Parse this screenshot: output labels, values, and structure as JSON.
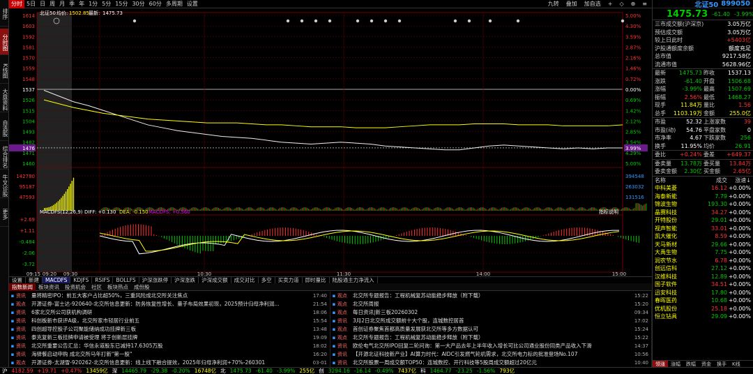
{
  "sidebar": {
    "items": [
      "排序",
      "分时图",
      "K线图",
      "大盘资料",
      "自选股",
      "综合排名",
      "牛叉诊股",
      "更多"
    ]
  },
  "topbar": {
    "items": [
      "分时",
      "5日",
      "日",
      "周",
      "月",
      "季",
      "年",
      "1分",
      "5分",
      "15分",
      "30分",
      "60分",
      "多周期",
      "设置"
    ],
    "right": [
      "九转",
      "叠加",
      "加自选",
      "+",
      "◇",
      "⊕",
      "≡"
    ]
  },
  "chart": {
    "header_name": "北证50",
    "header_junjia_label": "均价:",
    "header_junjia": "1502.85",
    "header_zuixin_label": "最新:",
    "header_zuixin": "1475.73",
    "y_labels": [
      "1614",
      "1603",
      "1592",
      "1581",
      "1570",
      "1559",
      "1548",
      "1537",
      "1526",
      "1515",
      "1504",
      "1493",
      "1482",
      "1471",
      "1460"
    ],
    "pct_labels": [
      "5.00%",
      "4.30%",
      "3.59%",
      "2.87%",
      "2.16%",
      "1.46%",
      "0.72%",
      "0.00%",
      "0.69%",
      "1.42%",
      "2.12%",
      "2.85%",
      "3.54%",
      "4.29%",
      "5.00%"
    ],
    "price_marker": "1476",
    "pct_marker": "3.99%",
    "vol_labels_left": [
      "142780",
      "95187",
      "47593"
    ],
    "vol_labels_right": [
      "394548",
      "263032",
      "131516"
    ],
    "macd_title": "MACDFS(12,26,9)",
    "macd_diff": "DIFF: +0.130",
    "macd_dea": "DEA: -0.150",
    "macd_macd": "MACDFS: +0.560",
    "macd_ylabels": [
      "+2.69",
      "+1.11",
      "-0.484",
      "-2.06",
      "-3.72"
    ],
    "macd_yright": [
      "+2.69",
      "+1.11",
      "-0.484",
      "-2.06",
      "-3.72"
    ],
    "time_labels": [
      "09:15",
      "09:20",
      "09:30",
      "10:30",
      "11:30",
      "14:00",
      "15:00"
    ],
    "indicator_help": "指标说明"
  },
  "tabs": [
    "设置",
    "新建",
    "MACDFS",
    "KDJFS",
    "RSIFS",
    "BOLLFS",
    "沪深涨跌停",
    "沪深涨跌",
    "沪深成交额",
    "成交对比",
    "多空",
    "买卖力道",
    "即时量比",
    "陆股通主力净流入"
  ],
  "news_tabs": [
    "指数新闻",
    "板块资讯",
    "投资机会",
    "社区",
    "板块热点",
    "成份股"
  ],
  "news_left": [
    {
      "tag": "资讯",
      "text": "量将精密IPO：前五大客户占比超50%，三重风险成北交所关注焦点",
      "date": "17:40"
    },
    {
      "tag": "观点",
      "text": "开源证券-富士达-920640-北交所信息更新：防务恢复性增长、量子布局效果初现，2025预计归母净利润...",
      "date": "21:54"
    },
    {
      "tag": "资讯",
      "text": "6家北交所公司获机构调研",
      "date": "18:06"
    },
    {
      "tag": "资讯",
      "text": "科创板新市获评A级，北交所家市轻居行业前五",
      "date": "15:54"
    },
    {
      "tag": "资讯",
      "text": "四创超导控股子公司聚能储纳成功挂牌新三板",
      "date": "13:48"
    },
    {
      "tag": "资讯",
      "text": "泰克复新三板挂牌申请被受理 将于创新层挂牌",
      "date": "19:09"
    },
    {
      "tag": "资讯",
      "text": "北交所重要公告汇总：华信永道股东已减持17.6305万股",
      "date": "18:02"
    },
    {
      "tag": "资讯",
      "text": "海驿餐启动申购 成北交所马年打新\"第一股\"",
      "date": "16:20"
    },
    {
      "tag": "观点",
      "text": "开源证券-太湖雪-920262-北交所信息更新：线上线下融合提效，2025年归母净利润+70%-260301",
      "date": "03-01"
    }
  ],
  "news_right": [
    {
      "tag": "观点",
      "text": "北交所专题报告：工程机械复苏动能稳步释放（附下载）",
      "date": "15:22"
    },
    {
      "tag": "观点",
      "text": "北交所周报",
      "date": "15:20"
    },
    {
      "tag": "观点",
      "text": "每日资讯|新三板20260302",
      "date": "09:34"
    },
    {
      "tag": "资讯",
      "text": "3月2日北交所成交额前十大个股，连城数控居首",
      "date": "17:02"
    },
    {
      "tag": "观点",
      "text": "首创证券聚焦首都高质量发展获北交所等多方数据认可",
      "date": "15:24"
    },
    {
      "tag": "观点",
      "text": "北交所专题报告：工程机械复苏动能稳步释放（附下载）",
      "date": "15:22"
    },
    {
      "tag": "资讯",
      "text": "欧伦电气北交所IPO回复二轮问询：第一大产品去年上半年收入增长可比公司通业股份同类产品收入下滑",
      "date": "14:37"
    },
    {
      "tag": "资讯",
      "text": "【开源北证科技新产业】AI算力时代：AIDC引发燃气轮机需求，北交所电力标的批准登场No.107",
      "date": "10:56"
    },
    {
      "tag": "资讯",
      "text": "北交所股票一周成交额TOP50：连城数控、开行科技等5股周成交额超过20亿元",
      "date": "10:40"
    },
    {
      "tag": "资讯",
      "text": "速顾科技北交所IPO3月5日上会",
      "date": "03-01"
    }
  ],
  "right": {
    "name": "北证50",
    "code": "899050",
    "price": "1475.73",
    "change": "-61.40",
    "pct": "-3.99%",
    "info": [
      {
        "l": "三市成交额(沪深京)",
        "v": "3.05万亿"
      },
      {
        "l": "预估成交额",
        "v": "3.05万亿"
      },
      {
        "l": "较上日此时",
        "v": "+5403亿"
      },
      {
        "l": "沪股通额度余额",
        "v": "额度充足"
      },
      {
        "l": "总市值",
        "v": "9217.58亿"
      },
      {
        "l": "流通市值",
        "v": "5628.96亿"
      }
    ],
    "quote": [
      {
        "l": "最新",
        "v": "1475.73",
        "l2": "昨收",
        "v2": "1537.13"
      },
      {
        "l": "涨跌",
        "v": "-61.40",
        "l2": "开盘",
        "v2": "1506.68"
      },
      {
        "l": "涨幅",
        "v": "-3.99%",
        "l2": "最高",
        "v2": "1507.69"
      },
      {
        "l": "振幅",
        "v": "2.56%",
        "l2": "最低",
        "v2": "1468.27"
      },
      {
        "l": "现手",
        "v": "11.84万",
        "l2": "量比",
        "v2": "1.56"
      },
      {
        "l": "总手",
        "v": "1103.19万",
        "l2": "金额",
        "v2": "255.0亿"
      }
    ],
    "quote2": [
      {
        "l": "市盈",
        "v": "52.32",
        "l2": "上涨家数",
        "v2": "39"
      },
      {
        "l": "市盈(动)",
        "v": "54.76",
        "l2": "平盘家数",
        "v2": "0"
      },
      {
        "l": "市净率",
        "v": "4.67",
        "l2": "下跌家数",
        "v2": "256"
      },
      {
        "l": "换手",
        "v": "11.95%",
        "l2": "均价",
        "v2": "26.91"
      }
    ],
    "quote3": [
      {
        "l": "委比",
        "v": "+0.24%",
        "l2": "委差",
        "v2": "+649.37"
      }
    ],
    "quote4": [
      {
        "l": "委卖量",
        "v": "13.78万",
        "l2": "委买量",
        "v2": "13.84万"
      },
      {
        "l": "委卖金额",
        "v": "2.30亿",
        "l2": "买金额",
        "v2": "2.65亿"
      }
    ],
    "stock_header": [
      "名称",
      "成交",
      "涨速↓"
    ],
    "stocks": [
      {
        "n": "中科美菱",
        "p": "16.12",
        "c": "+0.00%"
      },
      {
        "n": "海泰新能",
        "p": "7.79",
        "c": "+0.00%"
      },
      {
        "n": "锦波生物",
        "p": "193.30",
        "c": "+0.00%"
      },
      {
        "n": "晶赛科技",
        "p": "34.27",
        "c": "+0.00%"
      },
      {
        "n": "开特股份",
        "p": "29.01",
        "c": "+0.00%"
      },
      {
        "n": "视声智能",
        "p": "33.01",
        "c": "+0.00%"
      },
      {
        "n": "凯大催化",
        "p": "8.59",
        "c": "+0.00%"
      },
      {
        "n": "天马新材",
        "p": "29.66",
        "c": "+0.00%"
      },
      {
        "n": "大禹生物",
        "p": "7.75",
        "c": "+0.00%"
      },
      {
        "n": "润农节水",
        "p": "6.78",
        "c": "+0.00%"
      },
      {
        "n": "创远信科",
        "p": "27.12",
        "c": "+0.00%"
      },
      {
        "n": "汉维科技",
        "p": "12.89",
        "c": "+0.00%"
      },
      {
        "n": "国子软件",
        "p": "34.51",
        "c": "+0.00%"
      },
      {
        "n": "迅安科技",
        "p": "17.80",
        "c": "+0.00%"
      },
      {
        "n": "春晖医药",
        "p": "10.68",
        "c": "+0.00%"
      },
      {
        "n": "优机股份",
        "p": "25.18",
        "c": "+0.00%"
      },
      {
        "n": "恒立钻具",
        "p": "29.09",
        "c": "+0.00%"
      }
    ],
    "tabs": [
      "领涨",
      "涨幅",
      "跌幅",
      "资金",
      "换手",
      "K线"
    ]
  },
  "bottombar": [
    {
      "t": "沪",
      "c": "white"
    },
    {
      "t": "4182.59",
      "c": "red"
    },
    {
      "t": "+19.71",
      "c": "red"
    },
    {
      "t": "+0.47%",
      "c": "red"
    },
    {
      "t": "13459亿",
      "c": "yellow"
    },
    {
      "t": "深",
      "c": "white"
    },
    {
      "t": "14465.79",
      "c": "green"
    },
    {
      "t": "-29.38",
      "c": "green"
    },
    {
      "t": "-0.20%",
      "c": "green"
    },
    {
      "t": "16748亿",
      "c": "yellow"
    },
    {
      "t": "北",
      "c": "white"
    },
    {
      "t": "1475.73",
      "c": "green"
    },
    {
      "t": "-61.40",
      "c": "green"
    },
    {
      "t": "-3.99%",
      "c": "green"
    },
    {
      "t": "255亿",
      "c": "yellow"
    },
    {
      "t": "创",
      "c": "white"
    },
    {
      "t": "3294.16",
      "c": "green"
    },
    {
      "t": "-16.14",
      "c": "green"
    },
    {
      "t": "-0.49%",
      "c": "green"
    },
    {
      "t": "7437亿",
      "c": "yellow"
    },
    {
      "t": "科",
      "c": "white"
    },
    {
      "t": "1464.77",
      "c": "green"
    },
    {
      "t": "-23.25",
      "c": "green"
    },
    {
      "t": "-1.56%",
      "c": "green"
    },
    {
      "t": "793亿",
      "c": "yellow"
    }
  ]
}
